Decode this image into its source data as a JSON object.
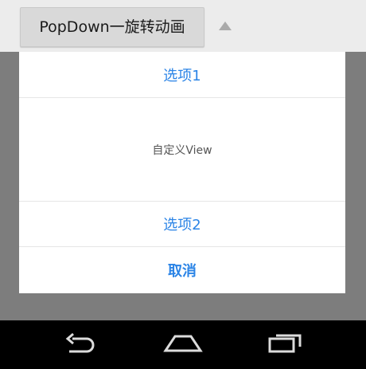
{
  "top_bar": {
    "button_label": "PopDown一旋转动画"
  },
  "popup": {
    "option1_label": "选项1",
    "custom_view_label": "自定义View",
    "option2_label": "选项2",
    "cancel_label": "取消"
  },
  "nav": {
    "back_icon": "back-icon",
    "home_icon": "home-icon",
    "recents_icon": "recents-icon"
  },
  "colors": {
    "accent": "#2b84e6",
    "dim_overlay": "#7d7d7d",
    "nav_bar": "#000000"
  }
}
